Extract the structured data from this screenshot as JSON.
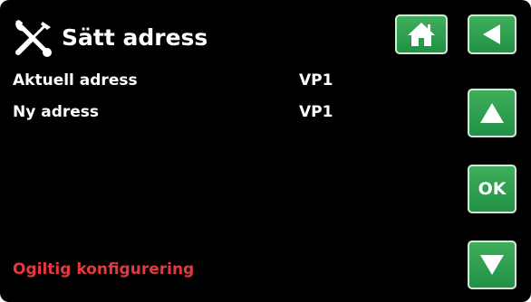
{
  "header": {
    "title": "Sätt adress",
    "icon": "tools-icon"
  },
  "rows": [
    {
      "label": "Aktuell adress",
      "value": "VP1"
    },
    {
      "label": "Ny adress",
      "value": "VP1"
    }
  ],
  "status": {
    "text": "Ogiltig konfigurering",
    "color": "#e5393d"
  },
  "buttons": {
    "home_icon": "home-icon",
    "back_icon": "back-arrow-icon",
    "up_icon": "arrow-up-icon",
    "ok_label": "OK",
    "down_icon": "arrow-down-icon",
    "color": "#2a9c4f"
  }
}
